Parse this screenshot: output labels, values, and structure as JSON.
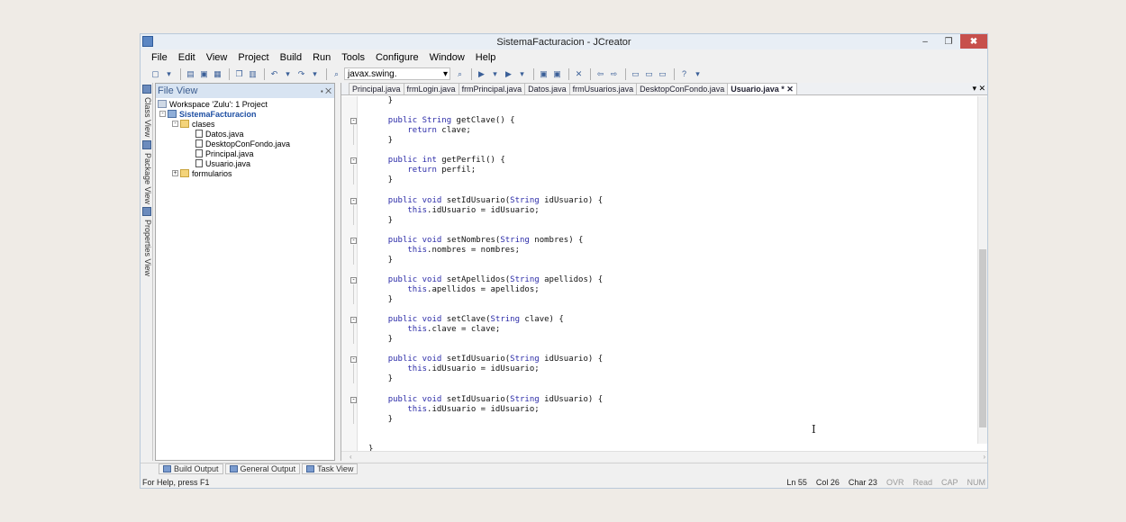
{
  "window": {
    "title": "SistemaFacturacion - JCreator",
    "controls": {
      "minimize": "–",
      "restore": "❐",
      "close": "✖"
    }
  },
  "menu": [
    "File",
    "Edit",
    "View",
    "Project",
    "Build",
    "Run",
    "Tools",
    "Configure",
    "Window",
    "Help"
  ],
  "toolbar": {
    "combo_value": "javax.swing."
  },
  "side_tabs": [
    "Class View",
    "Package View",
    "Properties View"
  ],
  "file_view": {
    "title": "File View",
    "pin": "⬝",
    "close": "✕",
    "workspace": "Workspace 'Zulu': 1 Project",
    "project": "SistemaFacturacion",
    "folders": [
      "clases",
      "formularios"
    ],
    "files": [
      "Datos.java",
      "DesktopConFondo.java",
      "Principal.java",
      "Usuario.java"
    ]
  },
  "editor": {
    "tabs": [
      "Principal.java",
      "frmLogin.java",
      "frmPrincipal.java",
      "Datos.java",
      "frmUsuarios.java",
      "DesktopConFondo.java",
      "Usuario.java *"
    ],
    "active_tab": "Usuario.java *",
    "tab_close": "✕",
    "tab_menu": "▾ ✕",
    "code": [
      "    }",
      "",
      "    public String getClave() {",
      "        return clave;",
      "    }",
      "",
      "    public int getPerfil() {",
      "        return perfil;",
      "    }",
      "",
      "    public void setIdUsuario(String idUsuario) {",
      "        this.idUsuario = idUsuario;",
      "    }",
      "",
      "    public void setNombres(String nombres) {",
      "        this.nombres = nombres;",
      "    }",
      "",
      "    public void setApellidos(String apellidos) {",
      "        this.apellidos = apellidos;",
      "    }",
      "",
      "    public void setClave(String clave) {",
      "        this.clave = clave;",
      "    }",
      "",
      "    public void setIdUsuario(String idUsuario) {",
      "        this.idUsuario = idUsuario;",
      "    }",
      "",
      "    public void setIdUsuario(String idUsuario) {",
      "        this.idUsuario = idUsuario;",
      "    }",
      "",
      "",
      "}"
    ]
  },
  "bottom_tabs": [
    "Build Output",
    "General Output",
    "Task View"
  ],
  "status": {
    "help": "For Help, press F1",
    "ln": "Ln 55",
    "col": "Col 26",
    "char": "Char 23",
    "ovr": "OVR",
    "read": "Read",
    "cap": "CAP",
    "num": "NUM"
  }
}
